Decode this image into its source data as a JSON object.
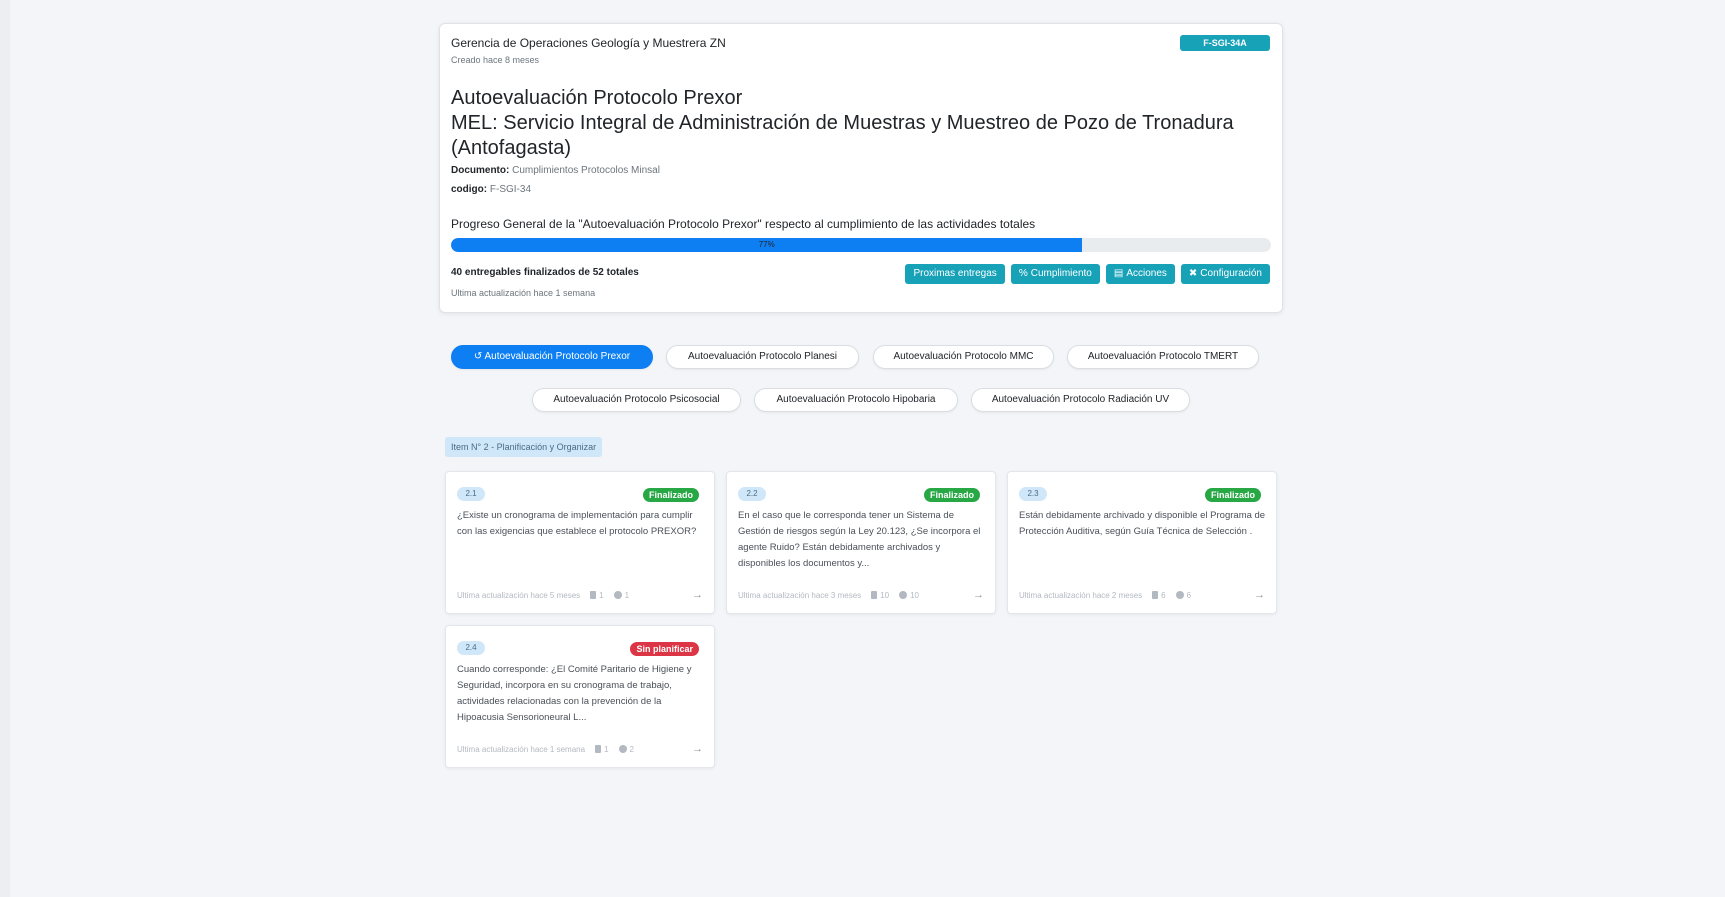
{
  "header": {
    "organization": "Gerencia de Operaciones Geología y Muestrera ZN",
    "created": "Creado hace 8 meses",
    "code_badge": "F-SGI-34A",
    "title_line1": "Autoevaluación Protocolo Prexor",
    "title_line2": "MEL: Servicio Integral de Administración de Muestras y Muestreo de Pozo de Tronadura (Antofagasta)",
    "document_label": "Documento:",
    "document_value": "Cumplimientos Protocolos Minsal",
    "codigo_label": "codigo:",
    "codigo_value": "F-SGI-34",
    "progress_title": "Progreso General de la \"Autoevaluación Protocolo Prexor\" respecto al cumplimiento de las actividades totales",
    "progress_percent": 77,
    "progress_label": "77%",
    "deliverables": "40 entregables finalizados de 52 totales",
    "last_update": "Ultima actualización hace 1 semana",
    "buttons": {
      "proximas": "Proximas entregas",
      "cumplimiento": "Cumplimiento",
      "acciones": "Acciones",
      "configuracion": "Configuración"
    }
  },
  "protocols": [
    "Autoevaluación Protocolo Prexor",
    "Autoevaluación Protocolo Planesi",
    "Autoevaluación Protocolo MMC",
    "Autoevaluación Protocolo TMERT",
    "Autoevaluación Protocolo Psicosocial",
    "Autoevaluación Protocolo Hipobaria",
    "Autoevaluación Protocolo Radiación UV"
  ],
  "section_label": "Item N° 2 - Planificación y Organizar",
  "items": [
    {
      "num": "2.1",
      "status": "Finalizado",
      "question": "¿Existe un cronograma de implementación para cumplir con las exigencias que establece el protocolo PREXOR?",
      "updated": "Ultima actualización hace 5 meses",
      "docs": "1",
      "comments": "1"
    },
    {
      "num": "2.2",
      "status": "Finalizado",
      "question": "En el caso que le corresponda tener un Sistema de Gestión de riesgos según la Ley 20.123, ¿Se incorpora el agente Ruido? Están debidamente archivados y disponibles los documentos y...",
      "updated": "Ultima actualización hace 3 meses",
      "docs": "10",
      "comments": "10"
    },
    {
      "num": "2.3",
      "status": "Finalizado",
      "question": "Están debidamente archivado y disponible el Programa de Protección Auditiva, según Guía Técnica de Selección .",
      "updated": "Ultima actualización hace 2 meses",
      "docs": "6",
      "comments": "6"
    },
    {
      "num": "2.4",
      "status": "Sin planificar",
      "question": "Cuando corresponde: ¿El Comité Paritario de Higiene y Seguridad, incorpora en su cronograma de trabajo, actividades relacionadas con la prevención de la Hipoacusia Sensorioneural L...",
      "updated": "Ultima actualización hace 1 semana",
      "docs": "1",
      "comments": "2"
    }
  ],
  "colors": {
    "finalizado": "#28a745",
    "sin_planificar": "#dc3545",
    "primary": "#0d7ff2",
    "info": "#17a2b8"
  },
  "icons": {
    "refresh": "refresh-icon",
    "percent": "percent-icon",
    "file": "file-icon",
    "tools": "tools-icon",
    "arrow": "arrow-right-icon"
  }
}
